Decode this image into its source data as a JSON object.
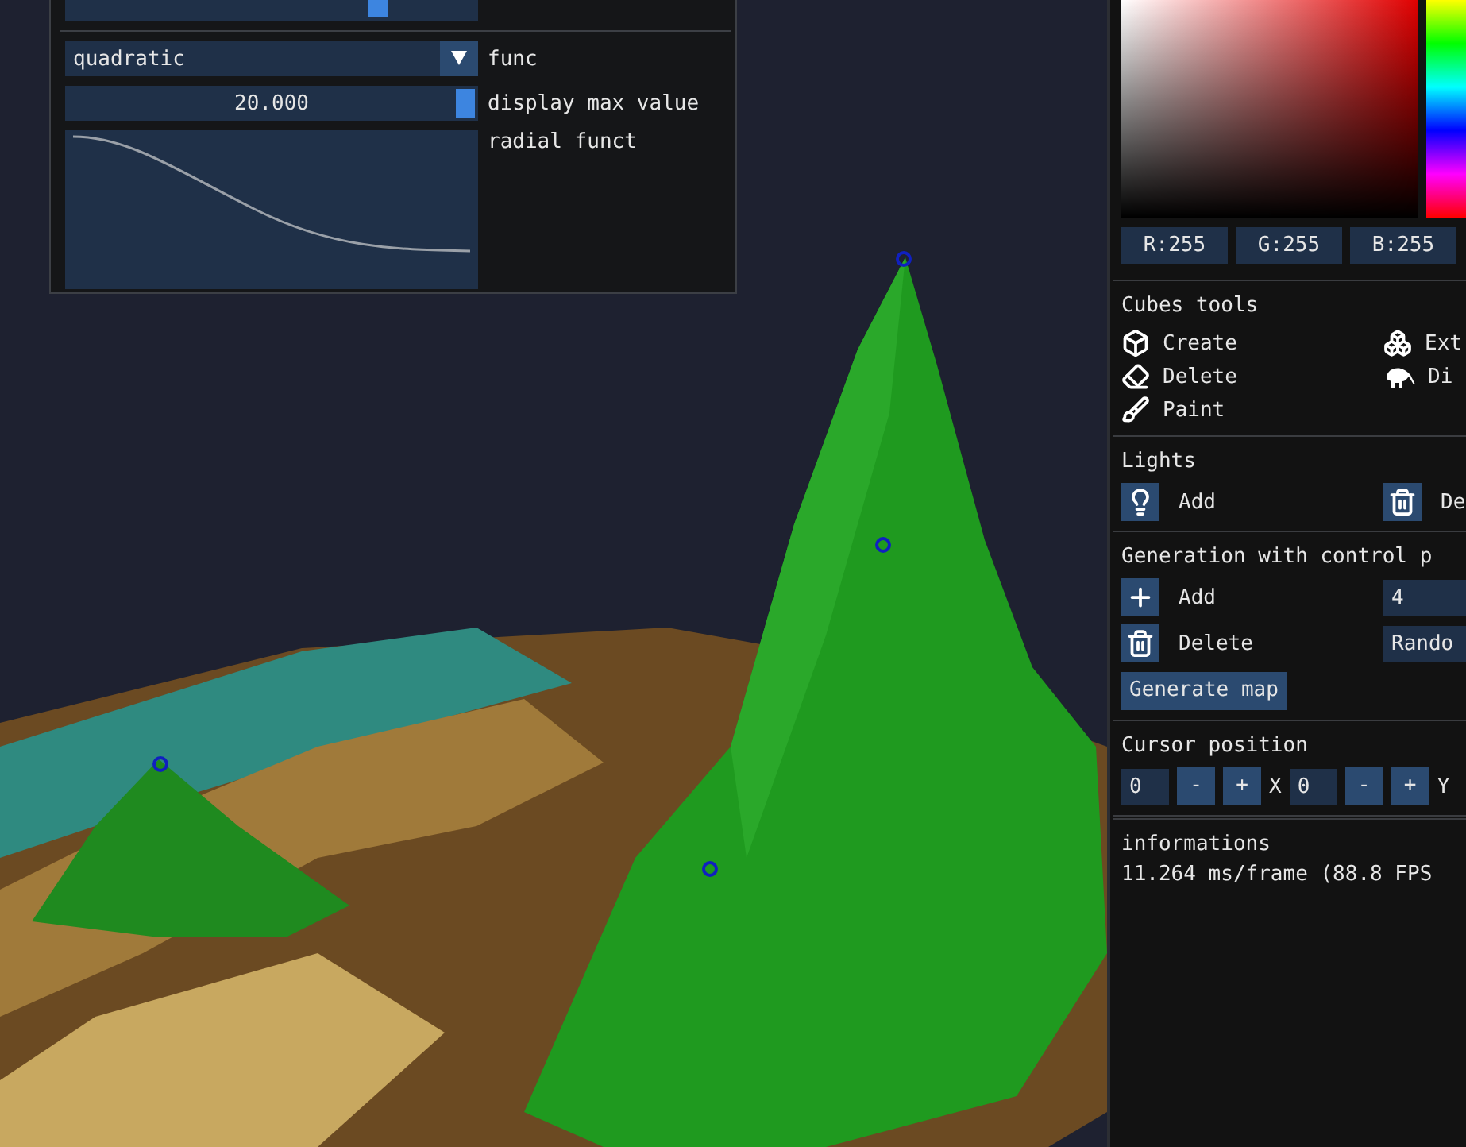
{
  "settings_panel": {
    "top_slider": {
      "level": 0.77
    },
    "func_select": {
      "value": "quadratic",
      "label": "func"
    },
    "max_slider": {
      "value": "20.000",
      "level": 1,
      "label": "display max value"
    },
    "graph": {
      "label": "radial funct"
    }
  },
  "color_picker": {
    "fields": [
      "R:255",
      "G:255",
      "B:255"
    ]
  },
  "cubes_tools": {
    "title": "Cubes tools",
    "tools": [
      {
        "label": "Create",
        "kind": "cube"
      },
      {
        "label": "Ext",
        "kind": "cubes"
      },
      {
        "label": "Delete",
        "kind": "eraser"
      },
      {
        "label": "Di",
        "kind": "bird"
      },
      {
        "label": "Paint",
        "kind": "brush"
      }
    ]
  },
  "lights": {
    "title": "Lights",
    "buttons": [
      {
        "label": "Add",
        "kind": "bulb"
      },
      {
        "label": "De",
        "kind": "trash"
      }
    ]
  },
  "generation": {
    "title": "Generation with control p",
    "buttons": [
      {
        "label": "Add",
        "kind": "plus"
      },
      {
        "label": "Delete",
        "kind": "trash"
      }
    ],
    "count": "4",
    "mode": "Rando",
    "generate": "Generate map"
  },
  "cursor": {
    "title": "Cursor position",
    "axes": [
      {
        "value": "0",
        "minus": "-",
        "plus": "+",
        "axis": "X"
      },
      {
        "value": "0",
        "minus": "-",
        "plus": "+",
        "axis": "Y"
      }
    ]
  },
  "info": {
    "title": "informations",
    "fps": "11.264 ms/frame (88.8 FPS"
  }
}
